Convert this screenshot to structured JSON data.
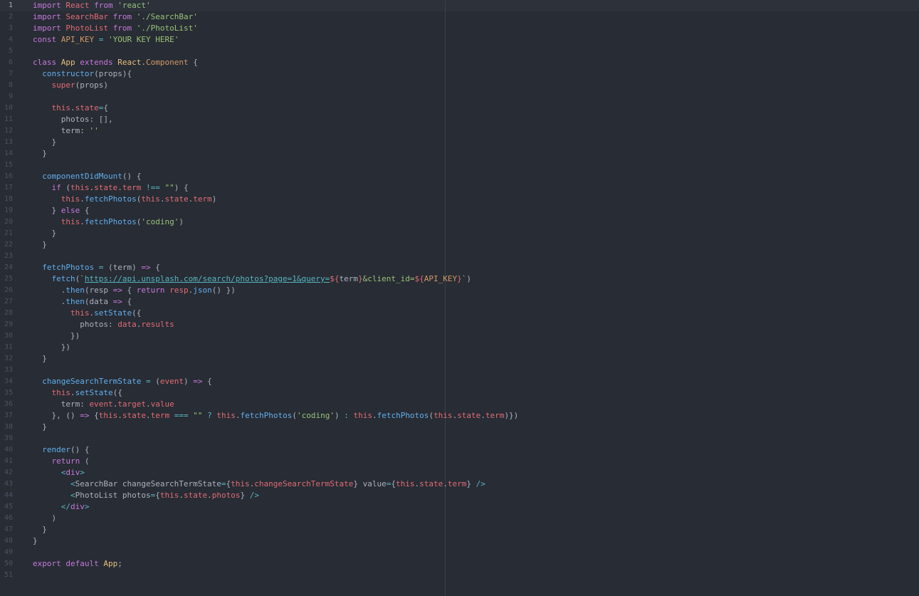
{
  "editor": {
    "language": "javascript",
    "active_line": 1,
    "wrap_guide_column": 80
  },
  "colors": {
    "background": "#282c34",
    "keyword": "#c678dd",
    "variable": "#e06c75",
    "string": "#98c379",
    "function": "#61afef",
    "class": "#e5c07b",
    "operator": "#56b6c2",
    "plain": "#abb2bf",
    "line_number": "#4b5263"
  },
  "lines": [
    [
      [
        "k",
        "import"
      ],
      [
        "p",
        " "
      ],
      [
        "v",
        "React"
      ],
      [
        "p",
        " "
      ],
      [
        "k",
        "from"
      ],
      [
        "p",
        " "
      ],
      [
        "s",
        "'react'"
      ]
    ],
    [
      [
        "k",
        "import"
      ],
      [
        "p",
        " "
      ],
      [
        "v",
        "SearchBar"
      ],
      [
        "p",
        " "
      ],
      [
        "k",
        "from"
      ],
      [
        "p",
        " "
      ],
      [
        "s",
        "'./SearchBar'"
      ]
    ],
    [
      [
        "k",
        "import"
      ],
      [
        "p",
        " "
      ],
      [
        "v",
        "PhotoList"
      ],
      [
        "p",
        " "
      ],
      [
        "k",
        "from"
      ],
      [
        "p",
        " "
      ],
      [
        "s",
        "'./PhotoList'"
      ]
    ],
    [
      [
        "k",
        "const"
      ],
      [
        "p",
        " "
      ],
      [
        "n",
        "API_KEY"
      ],
      [
        "p",
        " "
      ],
      [
        "o",
        "="
      ],
      [
        "p",
        " "
      ],
      [
        "s",
        "'YOUR KEY HERE'"
      ]
    ],
    [],
    [
      [
        "k",
        "class"
      ],
      [
        "p",
        " "
      ],
      [
        "c",
        "App"
      ],
      [
        "p",
        " "
      ],
      [
        "k",
        "extends"
      ],
      [
        "p",
        " "
      ],
      [
        "c",
        "React"
      ],
      [
        "p",
        "."
      ],
      [
        "n",
        "Component"
      ],
      [
        "p",
        " {"
      ]
    ],
    [
      [
        "p",
        "  "
      ],
      [
        "f",
        "constructor"
      ],
      [
        "p",
        "(props){"
      ]
    ],
    [
      [
        "p",
        "    "
      ],
      [
        "v",
        "super"
      ],
      [
        "p",
        "(props)"
      ]
    ],
    [],
    [
      [
        "p",
        "    "
      ],
      [
        "v",
        "this"
      ],
      [
        "p",
        "."
      ],
      [
        "v",
        "state"
      ],
      [
        "o",
        "="
      ],
      [
        "p",
        "{"
      ]
    ],
    [
      [
        "p",
        "      photos: [],"
      ]
    ],
    [
      [
        "p",
        "      term: "
      ],
      [
        "s",
        "''"
      ]
    ],
    [
      [
        "p",
        "    }"
      ]
    ],
    [
      [
        "p",
        "  }"
      ]
    ],
    [],
    [
      [
        "p",
        "  "
      ],
      [
        "f",
        "componentDidMount"
      ],
      [
        "p",
        "() {"
      ]
    ],
    [
      [
        "p",
        "    "
      ],
      [
        "k",
        "if"
      ],
      [
        "p",
        " ("
      ],
      [
        "v",
        "this"
      ],
      [
        "p",
        "."
      ],
      [
        "v",
        "state"
      ],
      [
        "p",
        "."
      ],
      [
        "v",
        "term"
      ],
      [
        "p",
        " "
      ],
      [
        "o",
        "!=="
      ],
      [
        "p",
        " "
      ],
      [
        "s",
        "\"\""
      ],
      [
        "p",
        ") {"
      ]
    ],
    [
      [
        "p",
        "      "
      ],
      [
        "v",
        "this"
      ],
      [
        "p",
        "."
      ],
      [
        "f",
        "fetchPhotos"
      ],
      [
        "p",
        "("
      ],
      [
        "v",
        "this"
      ],
      [
        "p",
        "."
      ],
      [
        "v",
        "state"
      ],
      [
        "p",
        "."
      ],
      [
        "v",
        "term"
      ],
      [
        "p",
        ")"
      ]
    ],
    [
      [
        "p",
        "    } "
      ],
      [
        "k",
        "else"
      ],
      [
        "p",
        " {"
      ]
    ],
    [
      [
        "p",
        "      "
      ],
      [
        "v",
        "this"
      ],
      [
        "p",
        "."
      ],
      [
        "f",
        "fetchPhotos"
      ],
      [
        "p",
        "("
      ],
      [
        "s",
        "'coding'"
      ],
      [
        "p",
        ")"
      ]
    ],
    [
      [
        "p",
        "    }"
      ]
    ],
    [
      [
        "p",
        "  }"
      ]
    ],
    [],
    [
      [
        "p",
        "  "
      ],
      [
        "f",
        "fetchPhotos"
      ],
      [
        "p",
        " "
      ],
      [
        "o",
        "="
      ],
      [
        "p",
        " (term) "
      ],
      [
        "k",
        "=>"
      ],
      [
        "p",
        " {"
      ]
    ],
    [
      [
        "p",
        "    "
      ],
      [
        "f",
        "fetch"
      ],
      [
        "p",
        "("
      ],
      [
        "s",
        "`"
      ],
      [
        "u",
        "https://api.unsplash.com/search/photos?page=1&query="
      ],
      [
        "t",
        "${"
      ],
      [
        "p",
        "term"
      ],
      [
        "t",
        "}"
      ],
      [
        "s",
        "&client_id="
      ],
      [
        "t",
        "${"
      ],
      [
        "n",
        "API_KEY"
      ],
      [
        "t",
        "}"
      ],
      [
        "s",
        "`"
      ],
      [
        "p",
        ")"
      ]
    ],
    [
      [
        "p",
        "      ."
      ],
      [
        "f",
        "then"
      ],
      [
        "p",
        "(resp "
      ],
      [
        "k",
        "=>"
      ],
      [
        "p",
        " { "
      ],
      [
        "k",
        "return"
      ],
      [
        "p",
        " "
      ],
      [
        "v",
        "resp"
      ],
      [
        "p",
        "."
      ],
      [
        "f",
        "json"
      ],
      [
        "p",
        "() })"
      ]
    ],
    [
      [
        "p",
        "      ."
      ],
      [
        "f",
        "then"
      ],
      [
        "p",
        "(data "
      ],
      [
        "k",
        "=>"
      ],
      [
        "p",
        " {"
      ]
    ],
    [
      [
        "p",
        "        "
      ],
      [
        "v",
        "this"
      ],
      [
        "p",
        "."
      ],
      [
        "f",
        "setState"
      ],
      [
        "p",
        "({"
      ]
    ],
    [
      [
        "p",
        "          photos: "
      ],
      [
        "v",
        "data"
      ],
      [
        "p",
        "."
      ],
      [
        "v",
        "results"
      ]
    ],
    [
      [
        "p",
        "        })"
      ]
    ],
    [
      [
        "p",
        "      })"
      ]
    ],
    [
      [
        "p",
        "  }"
      ]
    ],
    [],
    [
      [
        "p",
        "  "
      ],
      [
        "f",
        "changeSearchTermState"
      ],
      [
        "p",
        " "
      ],
      [
        "o",
        "="
      ],
      [
        "p",
        " ("
      ],
      [
        "v",
        "event"
      ],
      [
        "p",
        ") "
      ],
      [
        "k",
        "=>"
      ],
      [
        "p",
        " {"
      ]
    ],
    [
      [
        "p",
        "    "
      ],
      [
        "v",
        "this"
      ],
      [
        "p",
        "."
      ],
      [
        "f",
        "setState"
      ],
      [
        "p",
        "({"
      ]
    ],
    [
      [
        "p",
        "      term: "
      ],
      [
        "v",
        "event"
      ],
      [
        "p",
        "."
      ],
      [
        "v",
        "target"
      ],
      [
        "p",
        "."
      ],
      [
        "v",
        "value"
      ]
    ],
    [
      [
        "p",
        "    }, () "
      ],
      [
        "k",
        "=>"
      ],
      [
        "p",
        " {"
      ],
      [
        "v",
        "this"
      ],
      [
        "p",
        "."
      ],
      [
        "v",
        "state"
      ],
      [
        "p",
        "."
      ],
      [
        "v",
        "term"
      ],
      [
        "p",
        " "
      ],
      [
        "o",
        "==="
      ],
      [
        "p",
        " "
      ],
      [
        "s",
        "\"\""
      ],
      [
        "p",
        " "
      ],
      [
        "o",
        "?"
      ],
      [
        "p",
        " "
      ],
      [
        "v",
        "this"
      ],
      [
        "p",
        "."
      ],
      [
        "f",
        "fetchPhotos"
      ],
      [
        "p",
        "("
      ],
      [
        "s",
        "'coding'"
      ],
      [
        "p",
        ") "
      ],
      [
        "o",
        ":"
      ],
      [
        "p",
        " "
      ],
      [
        "v",
        "this"
      ],
      [
        "p",
        "."
      ],
      [
        "f",
        "fetchPhotos"
      ],
      [
        "p",
        "("
      ],
      [
        "v",
        "this"
      ],
      [
        "p",
        "."
      ],
      [
        "v",
        "state"
      ],
      [
        "p",
        "."
      ],
      [
        "v",
        "term"
      ],
      [
        "p",
        ")})"
      ]
    ],
    [
      [
        "p",
        "  }"
      ]
    ],
    [],
    [
      [
        "p",
        "  "
      ],
      [
        "f",
        "render"
      ],
      [
        "p",
        "() {"
      ]
    ],
    [
      [
        "p",
        "    "
      ],
      [
        "k",
        "return"
      ],
      [
        "p",
        " ("
      ]
    ],
    [
      [
        "p",
        "      "
      ],
      [
        "o",
        "<"
      ],
      [
        "k",
        "div"
      ],
      [
        "o",
        ">"
      ]
    ],
    [
      [
        "p",
        "        "
      ],
      [
        "o",
        "<"
      ],
      [
        "p",
        "SearchBar changeSearchTermState"
      ],
      [
        "o",
        "="
      ],
      [
        "p",
        "{"
      ],
      [
        "v",
        "this"
      ],
      [
        "p",
        "."
      ],
      [
        "v",
        "changeSearchTermState"
      ],
      [
        "p",
        "} value"
      ],
      [
        "o",
        "="
      ],
      [
        "p",
        "{"
      ],
      [
        "v",
        "this"
      ],
      [
        "p",
        "."
      ],
      [
        "v",
        "state"
      ],
      [
        "p",
        "."
      ],
      [
        "v",
        "term"
      ],
      [
        "p",
        "} "
      ],
      [
        "o",
        "/>"
      ]
    ],
    [
      [
        "p",
        "        "
      ],
      [
        "o",
        "<"
      ],
      [
        "p",
        "PhotoList photos"
      ],
      [
        "o",
        "="
      ],
      [
        "p",
        "{"
      ],
      [
        "v",
        "this"
      ],
      [
        "p",
        "."
      ],
      [
        "v",
        "state"
      ],
      [
        "p",
        "."
      ],
      [
        "v",
        "photos"
      ],
      [
        "p",
        "} "
      ],
      [
        "o",
        "/>"
      ]
    ],
    [
      [
        "p",
        "      "
      ],
      [
        "o",
        "</"
      ],
      [
        "k",
        "div"
      ],
      [
        "o",
        ">"
      ]
    ],
    [
      [
        "p",
        "    )"
      ]
    ],
    [
      [
        "p",
        "  }"
      ]
    ],
    [
      [
        "p",
        "}"
      ]
    ],
    [],
    [
      [
        "k",
        "export"
      ],
      [
        "p",
        " "
      ],
      [
        "k",
        "default"
      ],
      [
        "p",
        " "
      ],
      [
        "c",
        "App"
      ],
      [
        "p",
        ";"
      ]
    ],
    []
  ]
}
